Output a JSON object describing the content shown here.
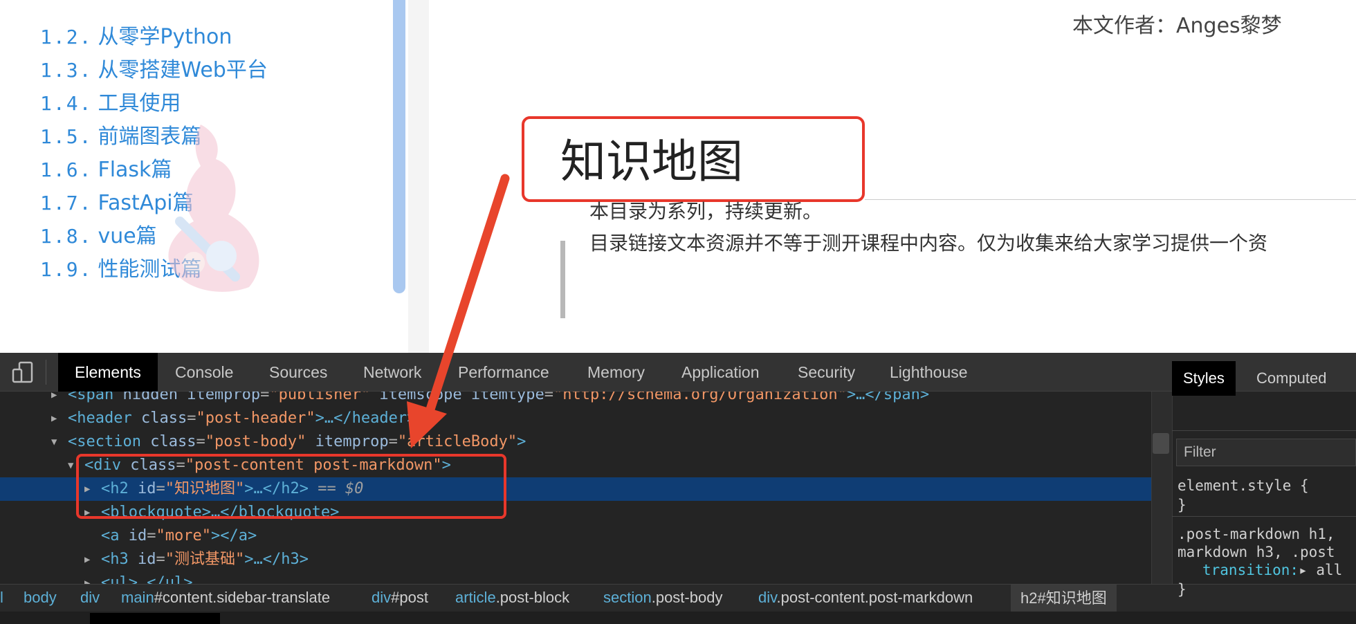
{
  "toc": {
    "items": [
      {
        "num": "1.2.",
        "label": "从零学Python"
      },
      {
        "num": "1.3.",
        "label": "从零搭建Web平台"
      },
      {
        "num": "1.4.",
        "label": "工具使用"
      },
      {
        "num": "1.5.",
        "label": "前端图表篇"
      },
      {
        "num": "1.6.",
        "label": "Flask篇"
      },
      {
        "num": "1.7.",
        "label": "FastApi篇"
      },
      {
        "num": "1.8.",
        "label": "vue篇"
      },
      {
        "num": "1.9.",
        "label": "性能测试篇"
      }
    ]
  },
  "article": {
    "author": "本文作者：Anges黎梦",
    "heading": "知识地图",
    "quote_lines": [
      "本目录为系列，持续更新。",
      "目录链接文本资源并不等于测开课程中内容。仅为收集来给大家学习提供一个资"
    ]
  },
  "devtools": {
    "tabs": [
      "Elements",
      "Console",
      "Sources",
      "Network",
      "Performance",
      "Memory",
      "Application",
      "Security",
      "Lighthouse"
    ],
    "active_tab": "Elements",
    "dom_lines": [
      {
        "tri": "▶",
        "parts": [
          [
            "tag",
            "<span "
          ],
          [
            "attr",
            "hidden itemprop"
          ],
          [
            "eq",
            "="
          ],
          [
            "val",
            "\"publisher\""
          ],
          [
            "attr",
            " itemscope itemtype"
          ],
          [
            "eq",
            "="
          ],
          [
            "val",
            "\"http://schema.org/Organization\""
          ],
          [
            "tag",
            ">…</span>"
          ]
        ]
      },
      {
        "tri": "▶",
        "parts": [
          [
            "tag",
            "<header "
          ],
          [
            "attr",
            "class"
          ],
          [
            "eq",
            "="
          ],
          [
            "val",
            "\"post-header\""
          ],
          [
            "tag",
            ">…</header>"
          ]
        ]
      },
      {
        "tri": "▼",
        "parts": [
          [
            "tag",
            "<section "
          ],
          [
            "attr",
            "class"
          ],
          [
            "eq",
            "="
          ],
          [
            "val",
            "\"post-body\""
          ],
          [
            "attr",
            " itemprop"
          ],
          [
            "eq",
            "="
          ],
          [
            "val",
            "\"articleBody\""
          ],
          [
            "tag",
            ">"
          ]
        ]
      },
      {
        "tri": "▼",
        "parts": [
          [
            "tag",
            "<div "
          ],
          [
            "attr",
            "class"
          ],
          [
            "eq",
            "="
          ],
          [
            "val",
            "\"post-content post-markdown\""
          ],
          [
            "tag",
            ">"
          ]
        ]
      },
      {
        "tri": "▶",
        "parts": [
          [
            "tag",
            "<h2 "
          ],
          [
            "attr",
            "id"
          ],
          [
            "eq",
            "="
          ],
          [
            "val",
            "\"知识地图\""
          ],
          [
            "tag",
            ">…</h2>"
          ],
          [
            "ref",
            " == $0"
          ]
        ]
      },
      {
        "tri": "▶",
        "parts": [
          [
            "tag",
            "<blockquote>…</blockquote>"
          ]
        ]
      },
      {
        "tri": "",
        "parts": [
          [
            "tag",
            "<a "
          ],
          [
            "attr",
            "id"
          ],
          [
            "eq",
            "="
          ],
          [
            "val",
            "\"more\""
          ],
          [
            "tag",
            "></a>"
          ]
        ]
      },
      {
        "tri": "▶",
        "parts": [
          [
            "tag",
            "<h3 "
          ],
          [
            "attr",
            "id"
          ],
          [
            "eq",
            "="
          ],
          [
            "val",
            "\"测试基础\""
          ],
          [
            "tag",
            ">…</h3>"
          ]
        ]
      },
      {
        "tri": "▶",
        "parts": [
          [
            "tag",
            "<ul>…</ul>"
          ]
        ]
      }
    ],
    "styles": {
      "tabs": [
        "Styles",
        "Computed"
      ],
      "filter_placeholder": "Filter",
      "lines": [
        {
          "text": "element.style {"
        },
        {
          "text": "}"
        },
        {
          "text": ".post-markdown h1,"
        },
        {
          "text": "markdown h3, .post"
        },
        {
          "prop": "transition:",
          "text": "▸ all"
        },
        {
          "text": "}"
        }
      ]
    },
    "breadcrumbs": [
      {
        "tag": "l",
        "rest": ""
      },
      {
        "tag": "body",
        "rest": ""
      },
      {
        "tag": "div",
        "rest": ""
      },
      {
        "tag": "main",
        "rest": "#content.sidebar-translate"
      },
      {
        "tag": "div",
        "rest": "#post"
      },
      {
        "tag": "article",
        "rest": ".post-block"
      },
      {
        "tag": "section",
        "rest": ".post-body"
      },
      {
        "tag": "div",
        "rest": ".post-content.post-markdown"
      },
      {
        "tag": "h2",
        "rest": "#知识地图"
      }
    ]
  },
  "colors": {
    "annotation_red": "#e8372b",
    "link_blue": "#2f89d8",
    "devtools_selected": "#0f3d74"
  }
}
